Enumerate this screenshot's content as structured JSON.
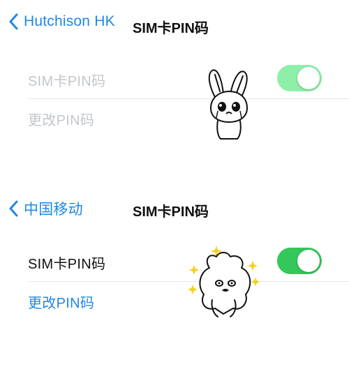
{
  "colors": {
    "accent": "#1e88e5",
    "toggle_on": "#34c759",
    "toggle_on_disabled": "#8ef0a8",
    "disabled_text": "#c2c6cc",
    "text": "#111111"
  },
  "screens": [
    {
      "back_label": "Hutchison HK",
      "title": "SIM卡PIN码",
      "rows": [
        {
          "label": "SIM卡PIN码",
          "toggle_on": true,
          "disabled": true
        },
        {
          "label": "更改PIN码",
          "disabled": true
        }
      ]
    },
    {
      "back_label": "中国移动",
      "title": "SIM卡PIN码",
      "rows": [
        {
          "label": "SIM卡PIN码",
          "toggle_on": true,
          "disabled": false
        },
        {
          "label": "更改PIN码",
          "disabled": false,
          "link": true
        }
      ]
    }
  ],
  "stickers": [
    {
      "name": "crying-bunny-sticker"
    },
    {
      "name": "sparkly-bunny-sticker"
    }
  ]
}
